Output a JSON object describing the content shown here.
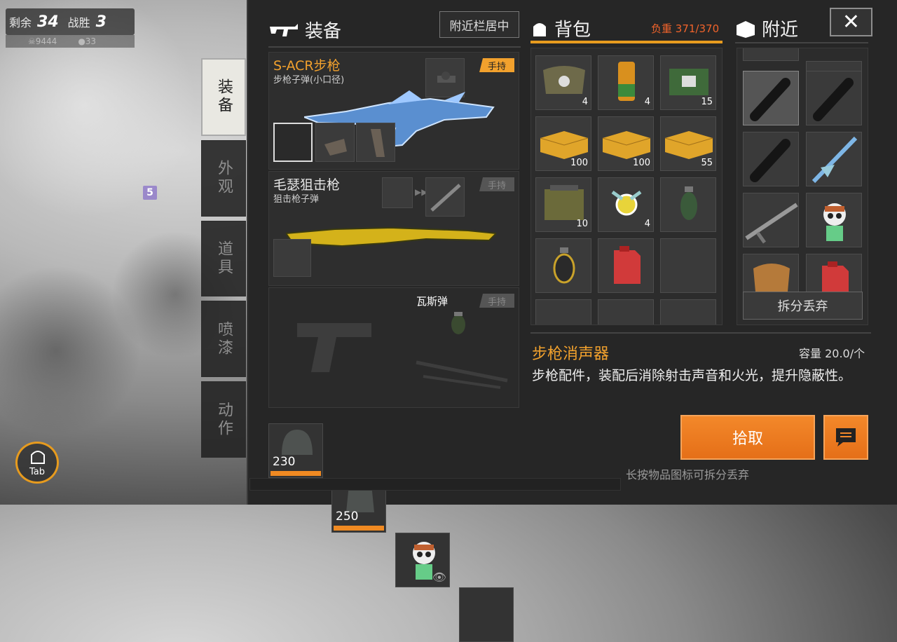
{
  "hud": {
    "remaining_label": "剩余",
    "remaining_value": "34",
    "wins_label": "战胜",
    "wins_value": "3",
    "kills_value": "9444",
    "other_value": "33",
    "badge": "5",
    "tab_label": "Tab"
  },
  "side_tabs": [
    {
      "label": "装备",
      "active": true
    },
    {
      "label": "外观",
      "active": false
    },
    {
      "label": "道具",
      "active": false
    },
    {
      "label": "喷漆",
      "active": false
    },
    {
      "label": "动作",
      "active": false
    }
  ],
  "equipment": {
    "title": "装备",
    "nearby_btn": "附近栏居中",
    "primary": {
      "name": "S-ACR步枪",
      "ammo": "步枪子弹(小口径)",
      "tag": "手持"
    },
    "secondary": {
      "name": "毛瑟狙击枪",
      "ammo": "狙击枪子弹",
      "tag": "手持"
    },
    "throwable": {
      "name": "瓦斯弹",
      "tag": "手持"
    },
    "armor": [
      {
        "value": "230",
        "icon": "helmet-icon"
      },
      {
        "value": "250",
        "icon": "vest-icon"
      },
      {
        "value": "",
        "icon": "panda-backpack-icon"
      },
      {
        "value": "",
        "icon": ""
      }
    ]
  },
  "backpack": {
    "title": "背包",
    "weight_label": "负重",
    "weight_value": "371/370",
    "items": [
      {
        "icon": "medkit-bag-icon",
        "count": "4"
      },
      {
        "icon": "energy-drink-icon",
        "count": "4"
      },
      {
        "icon": "bandage-icon",
        "count": "15"
      },
      {
        "icon": "ammo-box-icon",
        "count": "100"
      },
      {
        "icon": "ammo-box-icon",
        "count": "100"
      },
      {
        "icon": "ammo-box-icon",
        "count": "55"
      },
      {
        "icon": "ammo-can-icon",
        "count": "10"
      },
      {
        "icon": "winged-orb-icon",
        "count": "4"
      },
      {
        "icon": "smoke-grenade-icon",
        "count": ""
      },
      {
        "icon": "gas-grenade-icon",
        "count": ""
      },
      {
        "icon": "jerry-can-icon",
        "count": ""
      },
      {
        "icon": "",
        "count": ""
      }
    ]
  },
  "nearby": {
    "title": "附近",
    "items": [
      {
        "icon": "suppressor-icon",
        "selected": true
      },
      {
        "icon": "suppressor-icon",
        "selected": false
      },
      {
        "icon": "suppressor-icon",
        "selected": false
      },
      {
        "icon": "spear-weapon-icon",
        "selected": false
      },
      {
        "icon": "rifle-icon",
        "selected": false
      },
      {
        "icon": "panda-backpack-icon",
        "selected": false
      },
      {
        "icon": "bag-icon",
        "selected": false
      },
      {
        "icon": "jerry-can-icon",
        "selected": false
      }
    ],
    "split_btn": "拆分丢弃"
  },
  "detail": {
    "title": "步枪消声器",
    "capacity_label": "容量",
    "capacity_value": "20.0/个",
    "description": "步枪配件，装配后消除射击声音和火光，提升隐蔽性。",
    "pick_btn": "拾取",
    "hint": "长按物品图标可拆分丢弃"
  },
  "colors": {
    "accent": "#e79b1e",
    "warn": "#f0632b",
    "button": "#ee7b20"
  }
}
